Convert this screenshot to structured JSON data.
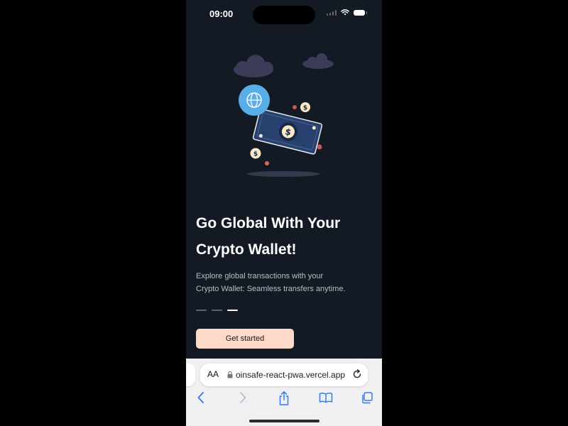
{
  "status_bar": {
    "time": "09:00"
  },
  "illustration": {
    "icons": [
      "cloud-icon",
      "globe-icon",
      "banknote-icon",
      "dollar-coin-icon"
    ],
    "colors": {
      "globe": "#5aaee8",
      "banknote": "#27406e",
      "coin": "#fde9c8",
      "cloud": "#3c3c58"
    }
  },
  "onboarding": {
    "title_line1": "Go Global With Your",
    "title_line2": "Crypto Wallet!",
    "subtitle_line1": "Explore global transactions with your",
    "subtitle_line2": "Crypto Wallet: Seamless transfers anytime.",
    "page_count": 3,
    "active_page": 3,
    "cta_label": "Get started"
  },
  "browser": {
    "text_size_label": "AA",
    "url": "oinsafe-react-pwa.vercel.app",
    "toolbar_icons": [
      "back-icon",
      "forward-icon",
      "share-icon",
      "bookmarks-icon",
      "tabs-icon"
    ]
  },
  "colors": {
    "background": "#141a23",
    "accent_button": "#fcd9c8",
    "text_primary": "#ffffff",
    "text_secondary": "#b9bec7",
    "safari_blue": "#2f7bf6"
  }
}
